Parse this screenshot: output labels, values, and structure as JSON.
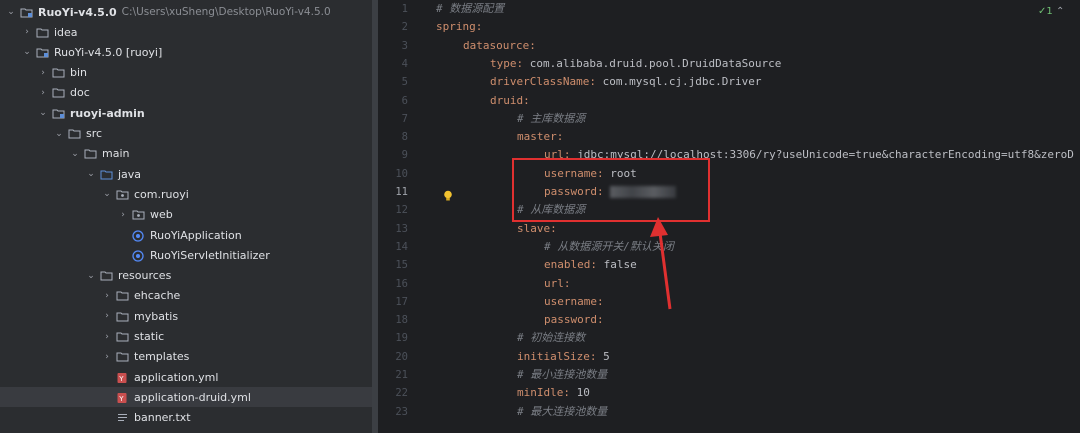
{
  "project_tree": {
    "root": {
      "name": "RuoYi-v4.5.0",
      "path": "C:\\Users\\xuSheng\\Desktop\\RuoYi-v4.5.0"
    },
    "items": [
      {
        "label": "idea",
        "depth": 1,
        "expanded": false,
        "icon": "folder-icon"
      },
      {
        "label": "RuoYi-v4.5.0 [ruoyi]",
        "depth": 1,
        "expanded": true,
        "icon": "module-folder-icon"
      },
      {
        "label": "bin",
        "depth": 2,
        "expanded": false,
        "icon": "folder-icon"
      },
      {
        "label": "doc",
        "depth": 2,
        "expanded": false,
        "icon": "folder-icon"
      },
      {
        "label": "ruoyi-admin",
        "depth": 2,
        "expanded": true,
        "icon": "module-folder-icon",
        "bold": true
      },
      {
        "label": "src",
        "depth": 3,
        "expanded": true,
        "icon": "folder-icon"
      },
      {
        "label": "main",
        "depth": 4,
        "expanded": true,
        "icon": "folder-icon"
      },
      {
        "label": "java",
        "depth": 5,
        "expanded": true,
        "icon": "source-folder-icon"
      },
      {
        "label": "com.ruoyi",
        "depth": 6,
        "expanded": true,
        "icon": "package-icon"
      },
      {
        "label": "web",
        "depth": 7,
        "expanded": false,
        "icon": "package-icon"
      },
      {
        "label": "RuoYiApplication",
        "depth": 7,
        "icon": "spring-class-icon"
      },
      {
        "label": "RuoYiServletInitializer",
        "depth": 7,
        "icon": "spring-class-icon"
      },
      {
        "label": "resources",
        "depth": 5,
        "expanded": true,
        "icon": "folder-icon"
      },
      {
        "label": "ehcache",
        "depth": 6,
        "expanded": false,
        "icon": "folder-icon"
      },
      {
        "label": "mybatis",
        "depth": 6,
        "expanded": false,
        "icon": "folder-icon"
      },
      {
        "label": "static",
        "depth": 6,
        "expanded": false,
        "icon": "folder-icon"
      },
      {
        "label": "templates",
        "depth": 6,
        "expanded": false,
        "icon": "folder-icon"
      },
      {
        "label": "application.yml",
        "depth": 6,
        "icon": "yaml-file-icon"
      },
      {
        "label": "application-druid.yml",
        "depth": 6,
        "icon": "yaml-file-icon",
        "selected": true
      },
      {
        "label": "banner.txt",
        "depth": 6,
        "icon": "text-file-icon"
      }
    ]
  },
  "editor": {
    "inspection_badge": "1",
    "current_line": 11,
    "lines": [
      {
        "n": "1",
        "indent": 0,
        "comment": "# 数据源配置"
      },
      {
        "n": "2",
        "indent": 0,
        "key": "spring:"
      },
      {
        "n": "3",
        "indent": 1,
        "key": "datasource:"
      },
      {
        "n": "4",
        "indent": 2,
        "key": "type:",
        "value": " com.alibaba.druid.pool.DruidDataSource"
      },
      {
        "n": "5",
        "indent": 2,
        "key": "driverClassName:",
        "value": " com.mysql.cj.jdbc.Driver"
      },
      {
        "n": "6",
        "indent": 2,
        "key": "druid:"
      },
      {
        "n": "7",
        "indent": 3,
        "comment": "# 主库数据源"
      },
      {
        "n": "8",
        "indent": 3,
        "key": "master:"
      },
      {
        "n": "9",
        "indent": 4,
        "key": "url:",
        "value": " jdbc:mysql://localhost:3306/ry?useUnicode=true&characterEncoding=utf8&zeroD"
      },
      {
        "n": "10",
        "indent": 4,
        "key": "username:",
        "value": " root"
      },
      {
        "n": "11",
        "indent": 4,
        "key": "password:",
        "value": " ",
        "redacted": true
      },
      {
        "n": "12",
        "indent": 3,
        "comment": "# 从库数据源"
      },
      {
        "n": "13",
        "indent": 3,
        "key": "slave:"
      },
      {
        "n": "14",
        "indent": 4,
        "comment": "# 从数据源开关/默认关闭"
      },
      {
        "n": "15",
        "indent": 4,
        "key": "enabled:",
        "value": " false"
      },
      {
        "n": "16",
        "indent": 4,
        "key": "url:"
      },
      {
        "n": "17",
        "indent": 4,
        "key": "username:"
      },
      {
        "n": "18",
        "indent": 4,
        "key": "password:"
      },
      {
        "n": "19",
        "indent": 3,
        "comment": "# 初始连接数"
      },
      {
        "n": "20",
        "indent": 3,
        "key": "initialSize:",
        "value": " 5"
      },
      {
        "n": "21",
        "indent": 3,
        "comment": "# 最小连接池数量"
      },
      {
        "n": "22",
        "indent": 3,
        "key": "minIdle:",
        "value": " 10"
      },
      {
        "n": "23",
        "indent": 3,
        "comment": "# 最大连接池数量"
      }
    ]
  },
  "colors": {
    "key": "#cf8e6d",
    "value": "#bcbec4",
    "comment": "#7a7e85",
    "highlight_box": "#e03030"
  }
}
